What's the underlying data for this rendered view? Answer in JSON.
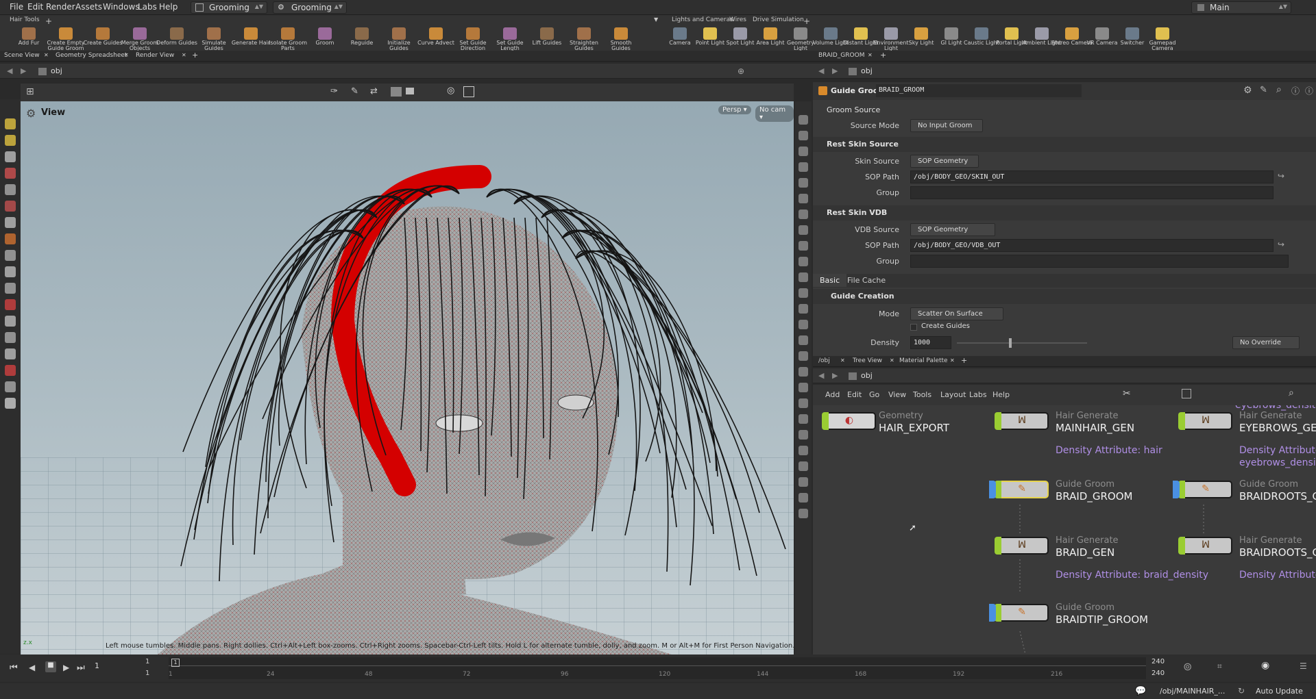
{
  "menubar": {
    "items": [
      "File",
      "Edit",
      "Render",
      "Assets",
      "Windows",
      "Labs",
      "Help"
    ],
    "desktop1": "Grooming",
    "desktop2": "Grooming",
    "main_select": "Main"
  },
  "shelf": {
    "left_tab": "Hair Tools",
    "left_tools": [
      "Add Fur",
      "Create Empty Guide Groom",
      "Create Guides",
      "Merge Groom Objects",
      "Deform Guides",
      "Simulate Guides",
      "Generate Hair",
      "Isolate Groom Parts",
      "Groom",
      "Reguide",
      "Initialize Guides",
      "Curve Advect",
      "Set Guide Direction",
      "Set Guide Length",
      "Lift Guides",
      "Straighten Guides",
      "Smooth Guides"
    ],
    "right_tabs": [
      "Lights and Cameras",
      "Wires",
      "Drive Simulation"
    ],
    "right_tools": [
      "Camera",
      "Point Light",
      "Spot Light",
      "Area Light",
      "Geometry Light",
      "Volume Light",
      "Distant Light",
      "Environment Light",
      "Sky Light",
      "GI Light",
      "Caustic Light",
      "Portal Light",
      "Ambient Light",
      "Stereo Camera",
      "VR Camera",
      "Switcher",
      "Gamepad Camera"
    ]
  },
  "left_pane": {
    "tabs": [
      "Scene View",
      "Geometry Spreadsheet",
      "Render View"
    ],
    "path": "obj"
  },
  "viewport": {
    "title": "View",
    "persp": "Persp",
    "cam": "No cam",
    "hint": "Left mouse tumbles. Middle pans. Right dollies. Ctrl+Alt+Left box-zooms. Ctrl+Right zooms. Spacebar-Ctrl-Left tilts. Hold L for alternate tumble, dolly, and zoom.  M or Alt+M for First Person Navigation.",
    "axis": "z.x"
  },
  "param_pane": {
    "tab": "BRAID_GROOM",
    "path": "obj",
    "node_type": "Guide Groom",
    "node_name": "BRAID_GROOM",
    "groom_source": "Groom Source",
    "source_mode_label": "Source Mode",
    "source_mode": "No Input Groom",
    "rest_skin": "Rest Skin Source",
    "skin_source_label": "Skin Source",
    "skin_source": "SOP Geometry",
    "sop_path_label": "SOP Path",
    "sop_path": "/obj/BODY_GEO/SKIN_OUT",
    "group_label": "Group",
    "rest_vdb": "Rest Skin VDB",
    "vdb_source_label": "VDB Source",
    "vdb_source": "SOP Geometry",
    "vdb_path": "/obj/BODY_GEO/VDB_OUT",
    "tabs": [
      "Basic",
      "File Cache"
    ],
    "guide_creation": "Guide Creation",
    "mode_label": "Mode",
    "mode": "Scatter On Surface",
    "create_guides": "Create Guides",
    "density_label": "Density",
    "density": "1000",
    "override": "No Override"
  },
  "network": {
    "tabs": [
      "/obj",
      "Tree View",
      "Material Palette"
    ],
    "path": "obj",
    "menu": [
      "Add",
      "Edit",
      "Go",
      "View",
      "Tools",
      "Layout",
      "Labs",
      "Help"
    ],
    "nodes": [
      {
        "type": "Geometry",
        "name": "HAIR_EXPORT",
        "attr": ""
      },
      {
        "type": "Hair Generate",
        "name": "MAINHAIR_GEN",
        "attr": "Density Attribute: hair"
      },
      {
        "type": "Hair Generate",
        "name": "EYEBROWS_GEN",
        "attr": "Density Attribute:",
        "attr2": "eyebrows_density",
        "attr_top": "eyebrows_density"
      },
      {
        "type": "Guide Groom",
        "name": "BRAID_GROOM",
        "attr": ""
      },
      {
        "type": "Guide Groom",
        "name": "BRAIDROOTS_GR",
        "attr": ""
      },
      {
        "type": "Hair Generate",
        "name": "BRAID_GEN",
        "attr": "Density Attribute: braid_density"
      },
      {
        "type": "Hair Generate",
        "name": "BRAIDROOTS_GE",
        "attr": "Density Attribute: h"
      },
      {
        "type": "Guide Groom",
        "name": "BRAIDTIP_GROOM",
        "attr": ""
      }
    ]
  },
  "timeline": {
    "frame": "1",
    "start": "1",
    "start2": "1",
    "end": "240",
    "end2": "240",
    "ticks": [
      "1",
      "24",
      "48",
      "72",
      "96",
      "120",
      "144",
      "168",
      "192",
      "216"
    ]
  },
  "status": {
    "path": "/obj/MAINHAIR_...",
    "update": "Auto Update"
  }
}
